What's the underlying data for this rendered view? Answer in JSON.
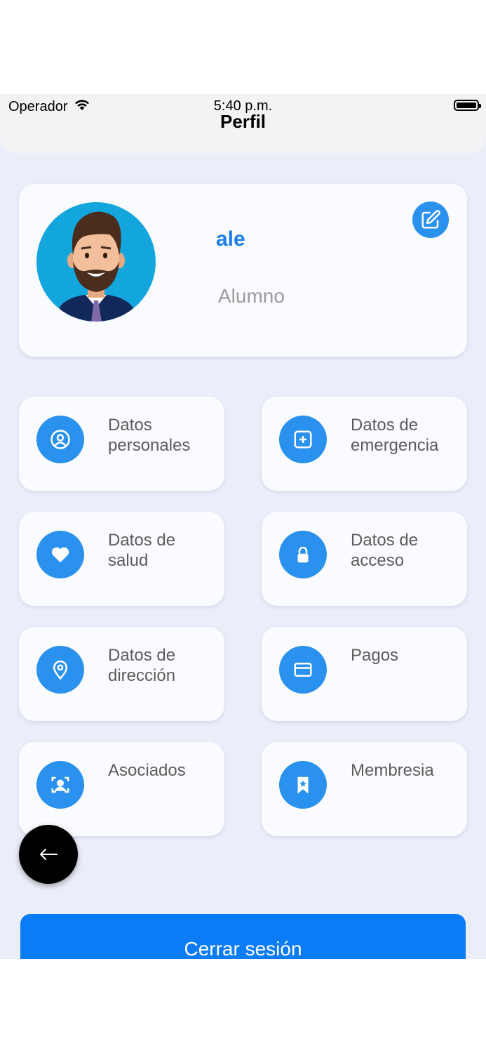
{
  "status_bar": {
    "carrier": "Operador",
    "time": "5:40 p.m."
  },
  "header": {
    "title": "Perfil"
  },
  "profile": {
    "name": "ale",
    "role": "Alumno"
  },
  "menu": [
    {
      "label": "Datos personales",
      "icon": "user-circle-icon"
    },
    {
      "label": "Datos de emergencia",
      "icon": "plus-square-icon"
    },
    {
      "label": "Datos de salud",
      "icon": "heart-icon"
    },
    {
      "label": "Datos de acceso",
      "icon": "lock-icon"
    },
    {
      "label": "Datos de dirección",
      "icon": "map-pin-icon"
    },
    {
      "label": "Pagos",
      "icon": "card-icon"
    },
    {
      "label": "Asociados",
      "icon": "scan-user-icon"
    },
    {
      "label": "Membresia",
      "icon": "bookmark-star-icon"
    }
  ],
  "logout": {
    "label": "Cerrar sesión"
  },
  "colors": {
    "accent": "#2a92ee",
    "logout": "#0b7cf7",
    "background": "#ebeef9",
    "name": "#1a7fe6"
  }
}
